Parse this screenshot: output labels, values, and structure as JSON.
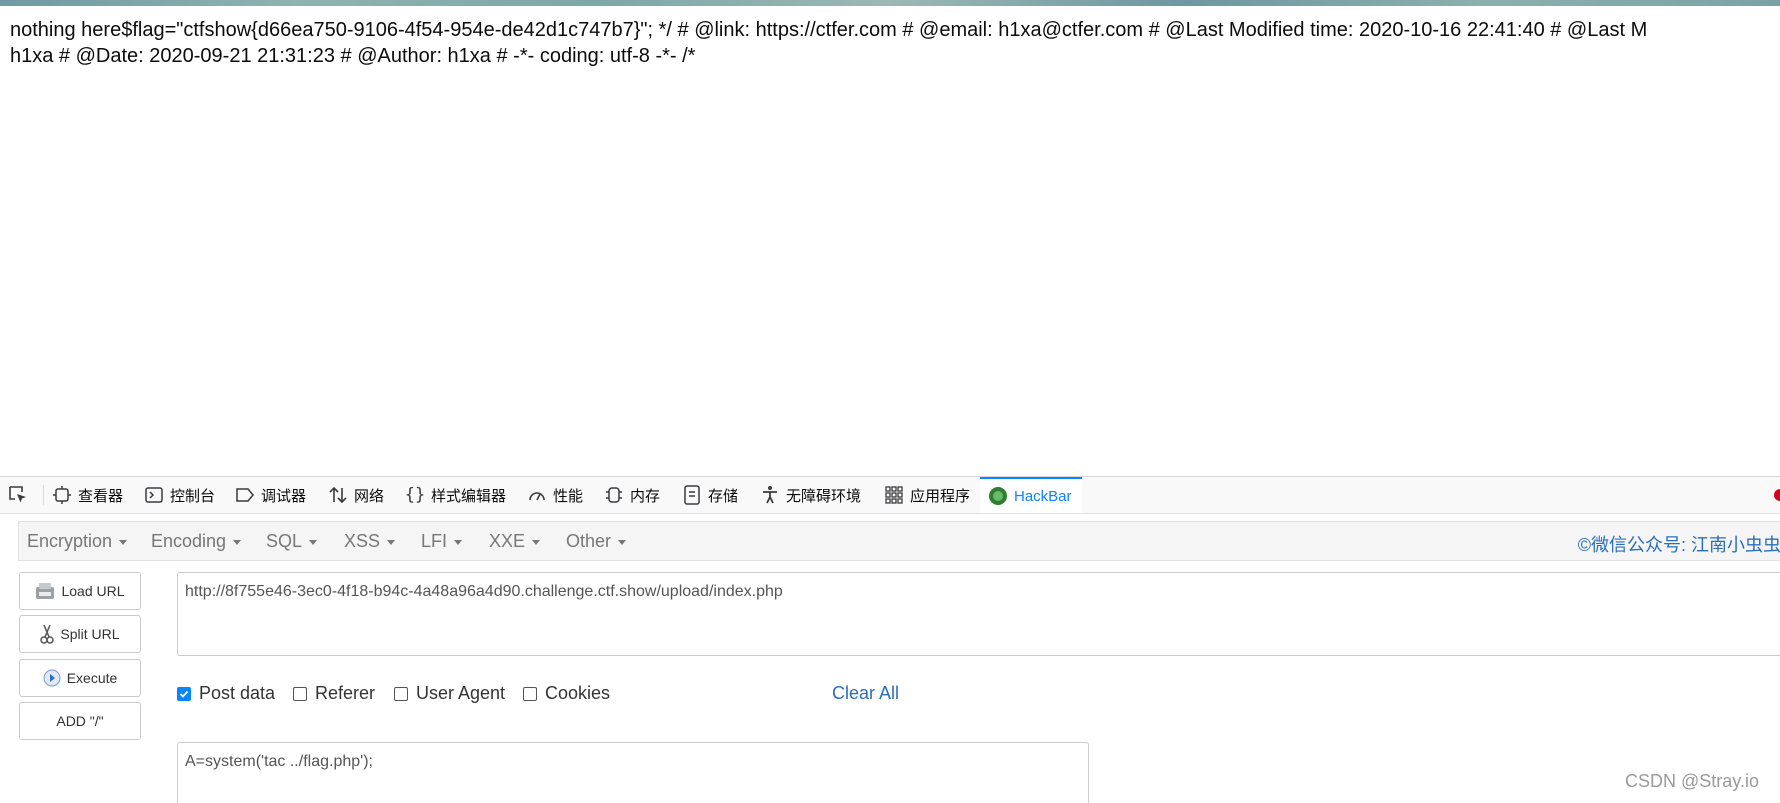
{
  "page": {
    "line1": "nothing here$flag=\"ctfshow{d66ea750-9106-4f54-954e-de42d1c747b7}\"; */ # @link: https://ctfer.com # @email: h1xa@ctfer.com # @Last Modified time: 2020-10-16 22:41:40 # @Last M",
    "line2": "h1xa # @Date: 2020-09-21 21:31:23 # @Author: h1xa # -*- coding: utf-8 -*- /*"
  },
  "devtools": {
    "tabs": [
      {
        "label": "查看器",
        "icon": "inspector-icon"
      },
      {
        "label": "控制台",
        "icon": "console-icon"
      },
      {
        "label": "调试器",
        "icon": "debugger-icon"
      },
      {
        "label": "网络",
        "icon": "network-icon"
      },
      {
        "label": "样式编辑器",
        "icon": "style-editor-icon"
      },
      {
        "label": "性能",
        "icon": "performance-icon"
      },
      {
        "label": "内存",
        "icon": "memory-icon"
      },
      {
        "label": "存储",
        "icon": "storage-icon"
      },
      {
        "label": "无障碍环境",
        "icon": "accessibility-icon"
      },
      {
        "label": "应用程序",
        "icon": "application-icon"
      },
      {
        "label": "HackBar",
        "icon": "hackbar-icon",
        "active": true
      }
    ],
    "accent": "#0a84ff"
  },
  "hackbar": {
    "menus": [
      "Encryption",
      "Encoding",
      "SQL",
      "XSS",
      "LFI",
      "XXE",
      "Other"
    ],
    "credit": "©微信公众号: 江南小虫虫",
    "buttons": {
      "load_url": "Load URL",
      "split_url": "Split URL",
      "execute": "Execute",
      "add_slash": "ADD \"/\""
    },
    "url": "http://8f755e46-3ec0-4f18-b94c-4a48a96a4d90.challenge.ctf.show/upload/index.php",
    "options": [
      {
        "label": "Post data",
        "checked": true
      },
      {
        "label": "Referer",
        "checked": false
      },
      {
        "label": "User Agent",
        "checked": false
      },
      {
        "label": "Cookies",
        "checked": false
      }
    ],
    "clear_all": "Clear All",
    "post_data": "A=system('tac ../flag.php');",
    "link_color": "#2a6ebb"
  },
  "watermark": "CSDN @Stray.io"
}
